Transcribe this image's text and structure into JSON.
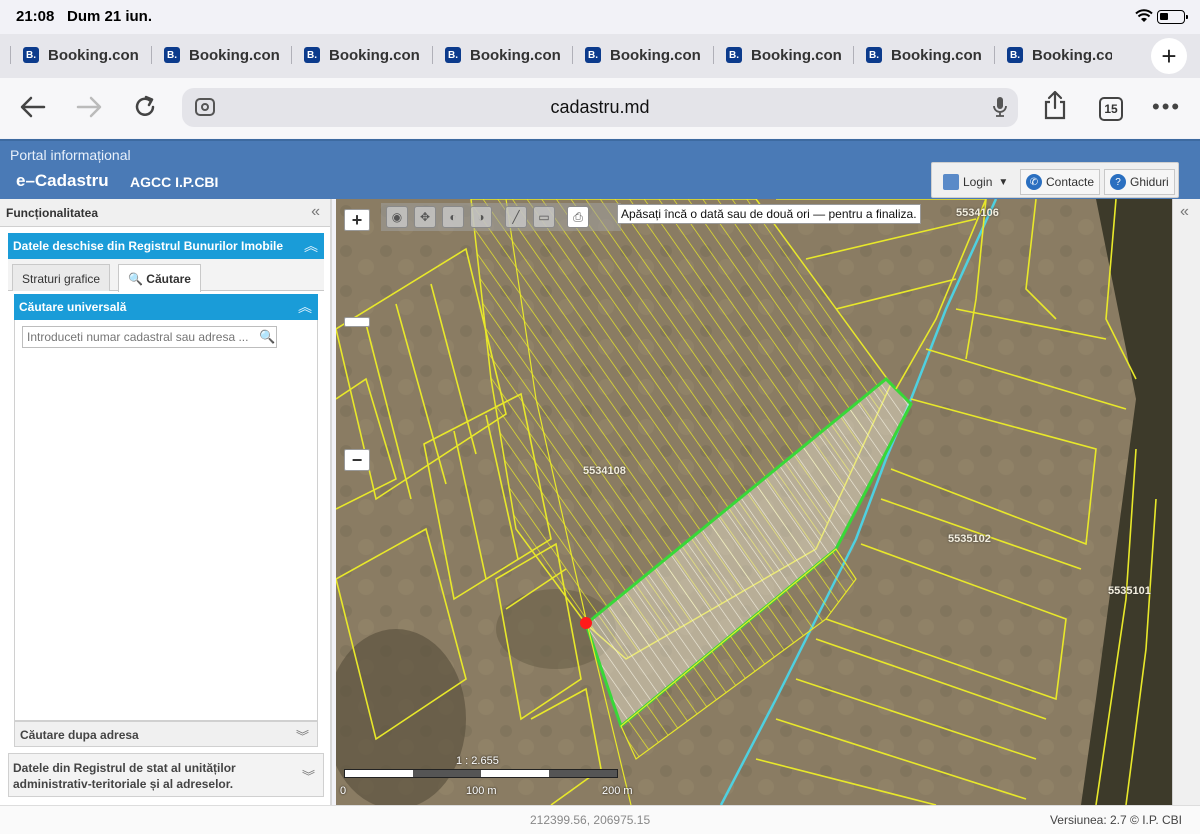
{
  "status_bar": {
    "time": "21:08",
    "date": "Dum 21 iun."
  },
  "browser": {
    "tabs": [
      {
        "favicon": "B.",
        "label": "Booking.con"
      },
      {
        "favicon": "B.",
        "label": "Booking.con"
      },
      {
        "favicon": "B.",
        "label": "Booking.con"
      },
      {
        "favicon": "B.",
        "label": "Booking.con"
      },
      {
        "favicon": "B.",
        "label": "Booking.con"
      },
      {
        "favicon": "B.",
        "label": "Booking.con"
      },
      {
        "favicon": "B.",
        "label": "Booking.con"
      },
      {
        "favicon": "B.",
        "label": "Booking.con"
      }
    ],
    "new_tab": "+",
    "url": "cadastru.md",
    "tab_count": "15",
    "more": "•••"
  },
  "header": {
    "subtitle": "Portal informațional",
    "brand": "e–Cadastru",
    "org": "AGCC I.P.CBI",
    "login_label": "Login",
    "contacte_label": "Contacte",
    "ghiduri_label": "Ghiduri"
  },
  "left_panel": {
    "title": "Funcționalitatea",
    "collapse": "«",
    "section1_title": "Datele deschise din Registrul Bunurilor Imobile",
    "tabs": [
      {
        "label": "Straturi grafice"
      },
      {
        "label": "Căutare"
      }
    ],
    "universal_search_title": "Căutare universală",
    "search_placeholder": "Introduceti numar cadastral sau adresa ...",
    "address_search_title": "Căutare dupa adresa",
    "section2_title": "Datele din Registrul de stat al unităților administrativ-teritoriale și al adreselor."
  },
  "map": {
    "tooltip": "Apăsați încă o dată sau de două ori — pentru a finaliza.",
    "zoom_in": "+",
    "zoom_out": "−",
    "parcel_labels": [
      {
        "text": "5534108"
      },
      {
        "text": "5535102"
      },
      {
        "text": "5535101"
      },
      {
        "text": "5534106"
      }
    ],
    "scale_ratio": "1 : 2.655",
    "scale_ticks": [
      "0",
      "100 m",
      "200 m"
    ],
    "colors": {
      "parcel_outline": "#e8e82a",
      "selection": "#38d838",
      "river": "#4fd0e0",
      "marker": "#ff1a1a"
    }
  },
  "right_strip": {
    "collapse": "«"
  },
  "footer": {
    "coordinates": "212399.56, 206975.15",
    "version": "Versiunea: 2.7 © I.P. CBI"
  }
}
